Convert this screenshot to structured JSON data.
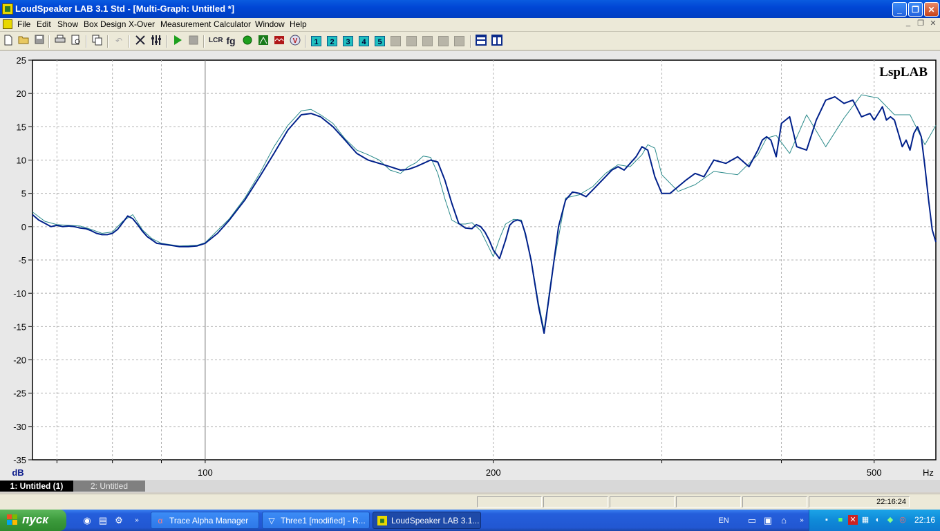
{
  "window": {
    "title": "LoudSpeaker LAB 3.1 Std - [Multi-Graph: Untitled *]",
    "minimize": "_",
    "restore": "❐",
    "close": "✕"
  },
  "menu": {
    "items": [
      "File",
      "Edit",
      "Show",
      "Box Design",
      "X-Over",
      "Measurement",
      "Calculator",
      "Window",
      "Help"
    ],
    "mdi_controls": [
      "_",
      "❐",
      "✕"
    ]
  },
  "toolbar": {
    "page_buttons": [
      "1",
      "2",
      "3",
      "4",
      "5"
    ],
    "icons": [
      "new-file-icon",
      "open-folder-icon",
      "save-icon",
      "print-icon",
      "print-preview-icon",
      "copy-icon",
      "undo-icon",
      "tools-icon",
      "sliders-icon",
      "play-icon",
      "stop-icon",
      "lcr-icon",
      "fg-icon",
      "green-circle-icon",
      "green-box-icon",
      "red-box-icon",
      "v-icon",
      "split-horizontal-icon",
      "split-vertical-icon"
    ],
    "fg_label": "fg"
  },
  "graph": {
    "logo": "LspLAB",
    "y_unit": "dB",
    "x_unit": "Hz",
    "y_ticks": [
      "25",
      "20",
      "15",
      "10",
      "5",
      "0",
      "-5",
      "-10",
      "-15",
      "-20",
      "-25",
      "-30",
      "-35"
    ],
    "x_tick_labels": [
      "100",
      "200",
      "500"
    ],
    "colors": {
      "background": "#ffffff",
      "grid": "#b0b0b0",
      "trace_main": "#00208a",
      "trace_secondary": "#2a8a8a"
    }
  },
  "chart_data": {
    "type": "line",
    "xscale": "log",
    "xlim": [
      66,
      580
    ],
    "ylim": [
      -35,
      25
    ],
    "xlabel": "Hz",
    "ylabel": "dB",
    "x_ticks_labeled": [
      100,
      200,
      500
    ],
    "y_ticks": [
      25,
      20,
      15,
      10,
      5,
      0,
      -5,
      -10,
      -15,
      -20,
      -25,
      -30,
      -35
    ],
    "grid": true,
    "series": [
      {
        "color": "#00208a",
        "x": [
          66,
          67,
          68,
          69,
          70,
          71,
          72,
          73,
          74,
          75,
          76,
          77,
          78,
          79,
          80,
          81,
          82,
          83,
          84,
          85,
          86,
          87,
          88,
          89,
          90,
          92,
          94,
          96,
          98,
          100,
          103,
          106,
          110,
          114,
          118,
          122,
          126,
          129,
          132,
          136,
          140,
          144,
          148,
          152,
          156,
          160,
          163,
          166,
          169,
          172,
          175,
          178,
          181,
          184,
          187,
          190,
          192,
          194,
          196,
          198,
          200,
          203,
          206,
          208,
          210,
          211,
          212,
          214,
          216,
          219,
          223,
          226,
          230,
          234,
          238,
          242,
          246,
          250,
          254,
          258,
          262,
          266,
          270,
          274,
          278,
          282,
          286,
          290,
          295,
          300,
          306,
          312,
          318,
          325,
          332,
          340,
          350,
          360,
          370,
          378,
          382,
          386,
          390,
          395,
          400,
          408,
          415,
          425,
          435,
          445,
          455,
          465,
          475,
          485,
          495,
          500,
          505,
          510,
          515,
          520,
          525,
          530,
          535,
          540,
          545,
          550,
          555,
          560,
          565,
          570,
          575,
          580
        ],
        "y": [
          1.8,
          1.0,
          0.5,
          0.0,
          0.2,
          0.0,
          0.1,
          0.0,
          -0.2,
          -0.3,
          -0.6,
          -1.0,
          -1.2,
          -1.2,
          -1.0,
          -0.4,
          0.6,
          1.6,
          1.2,
          0.3,
          -0.7,
          -1.5,
          -2.0,
          -2.5,
          -2.6,
          -2.8,
          -3.0,
          -3.0,
          -2.9,
          -2.5,
          -1.0,
          1.0,
          4.0,
          7.5,
          11.0,
          14.5,
          16.8,
          17.0,
          16.5,
          15.0,
          13.0,
          11.0,
          10.0,
          9.5,
          9.0,
          8.5,
          8.6,
          9.0,
          9.5,
          10.0,
          9.7,
          7.0,
          3.5,
          0.5,
          -0.2,
          -0.3,
          0.3,
          0.0,
          -0.8,
          -2.0,
          -3.5,
          -4.8,
          -2.0,
          0.2,
          0.8,
          0.9,
          1.0,
          0.8,
          -1.0,
          -5.0,
          -12.0,
          -16.0,
          -8.0,
          0.0,
          4.0,
          5.2,
          5.0,
          4.5,
          5.5,
          6.5,
          7.5,
          8.5,
          9.0,
          8.5,
          9.5,
          10.5,
          12.0,
          11.5,
          7.5,
          5.0,
          5.0,
          6.0,
          7.0,
          8.0,
          7.5,
          10.0,
          9.5,
          10.5,
          9.0,
          11.5,
          13.0,
          13.5,
          13.0,
          10.5,
          15.5,
          16.5,
          12.0,
          11.5,
          16.0,
          19.0,
          19.5,
          18.5,
          19.0,
          16.5,
          17.0,
          16.0,
          17.0,
          18.0,
          16.0,
          16.5,
          16.0,
          14.0,
          12.0,
          13.0,
          11.5,
          14.0,
          15.0,
          13.5,
          9.0,
          4.0,
          -0.5,
          -2.3
        ]
      },
      {
        "color": "#2a8a8a",
        "x": [
          66,
          68,
          70,
          72,
          74,
          76,
          78,
          80,
          82,
          84,
          86,
          88,
          90,
          94,
          98,
          100,
          106,
          110,
          114,
          118,
          122,
          126,
          129,
          132,
          136,
          140,
          144,
          148,
          152,
          156,
          160,
          163,
          166,
          169,
          172,
          175,
          178,
          181,
          184,
          187,
          190,
          194,
          198,
          200,
          203,
          206,
          210,
          214,
          219,
          223,
          226,
          230,
          238,
          246,
          254,
          262,
          270,
          278,
          286,
          290,
          295,
          300,
          312,
          325,
          340,
          360,
          378,
          386,
          395,
          408,
          425,
          445,
          465,
          485,
          505,
          525,
          545,
          565,
          580
        ],
        "y": [
          2.2,
          0.8,
          0.3,
          0.2,
          0.1,
          -0.4,
          -1.0,
          -0.8,
          0.8,
          1.8,
          -0.5,
          -1.8,
          -2.5,
          -2.9,
          -2.8,
          -2.4,
          1.2,
          4.3,
          8.0,
          12.0,
          15.2,
          17.4,
          17.6,
          16.8,
          15.5,
          13.2,
          11.5,
          10.8,
          10.0,
          8.5,
          8.0,
          9.0,
          9.6,
          10.6,
          10.4,
          8.0,
          4.2,
          1.0,
          0.4,
          0.4,
          0.6,
          -0.6,
          -3.2,
          -4.5,
          -1.8,
          0.4,
          1.1,
          1.0,
          -4.8,
          -11.5,
          -15.5,
          -7.5,
          4.3,
          4.8,
          6.0,
          8.0,
          9.3,
          9.0,
          10.8,
          12.3,
          11.8,
          7.8,
          5.3,
          6.3,
          8.3,
          7.8,
          10.8,
          13.3,
          13.7,
          11.0,
          16.8,
          12.0,
          16.3,
          19.8,
          19.3,
          16.8,
          16.8,
          12.3,
          15.2
        ]
      }
    ]
  },
  "status": {
    "tabs": [
      "1: Untitled (1)",
      "2: Untitled"
    ],
    "clock": "22:16:24"
  },
  "taskbar": {
    "start_label": "пуск",
    "tasks": [
      {
        "label": "Trace Alpha Manager",
        "active": false
      },
      {
        "label": "Three1 [modified] - R...",
        "active": false
      },
      {
        "label": "LoudSpeaker LAB 3.1...",
        "active": true
      }
    ],
    "language": "EN",
    "time": "22:16"
  }
}
